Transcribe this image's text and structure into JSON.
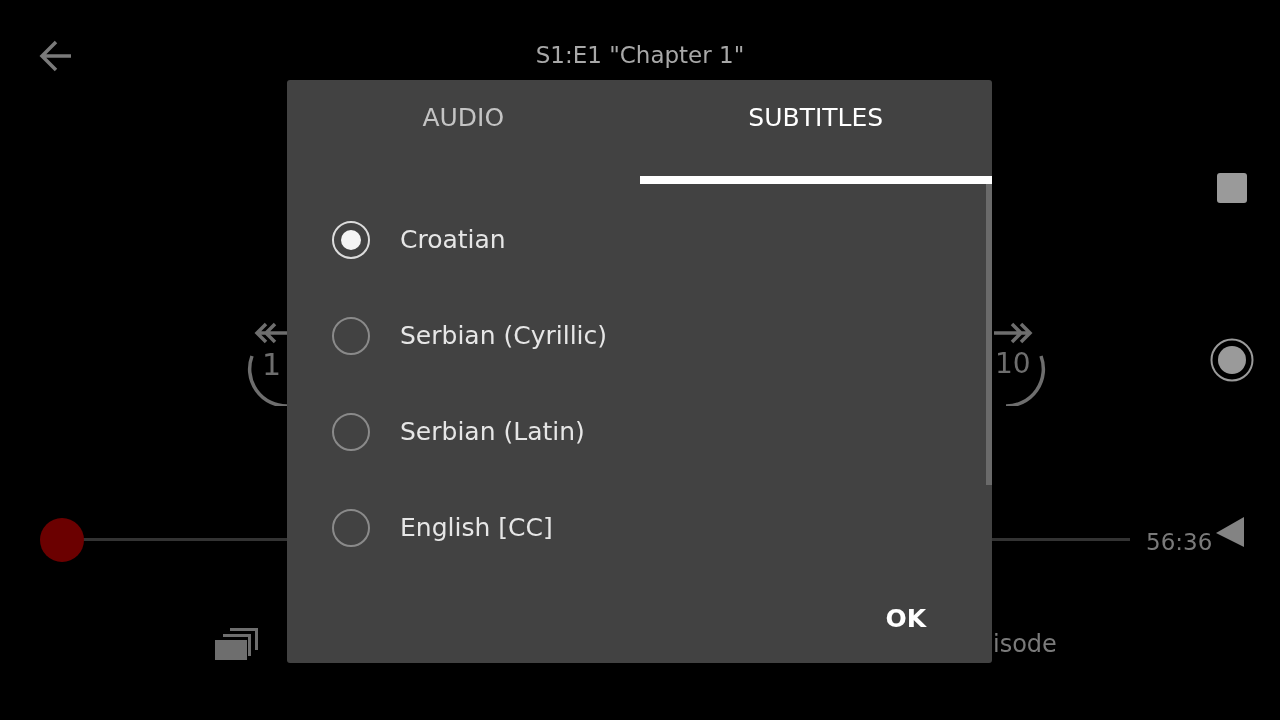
{
  "header": {
    "title": "S1:E1 \"Chapter 1\""
  },
  "player": {
    "rewind_label": "1",
    "forward_label": "10",
    "progress": {
      "level": 0.0
    },
    "time_remaining": "56:36",
    "next_episode_label": "isode"
  },
  "dialog": {
    "tabs": [
      {
        "label": "AUDIO",
        "selected": false
      },
      {
        "label": "SUBTITLES",
        "selected": true
      }
    ],
    "options": [
      {
        "label": "Croatian",
        "selected": true
      },
      {
        "label": "Serbian (Cyrillic)",
        "selected": false
      },
      {
        "label": "Serbian (Latin)",
        "selected": false
      },
      {
        "label": "English [CC]",
        "selected": false
      }
    ],
    "ok": "OK"
  }
}
